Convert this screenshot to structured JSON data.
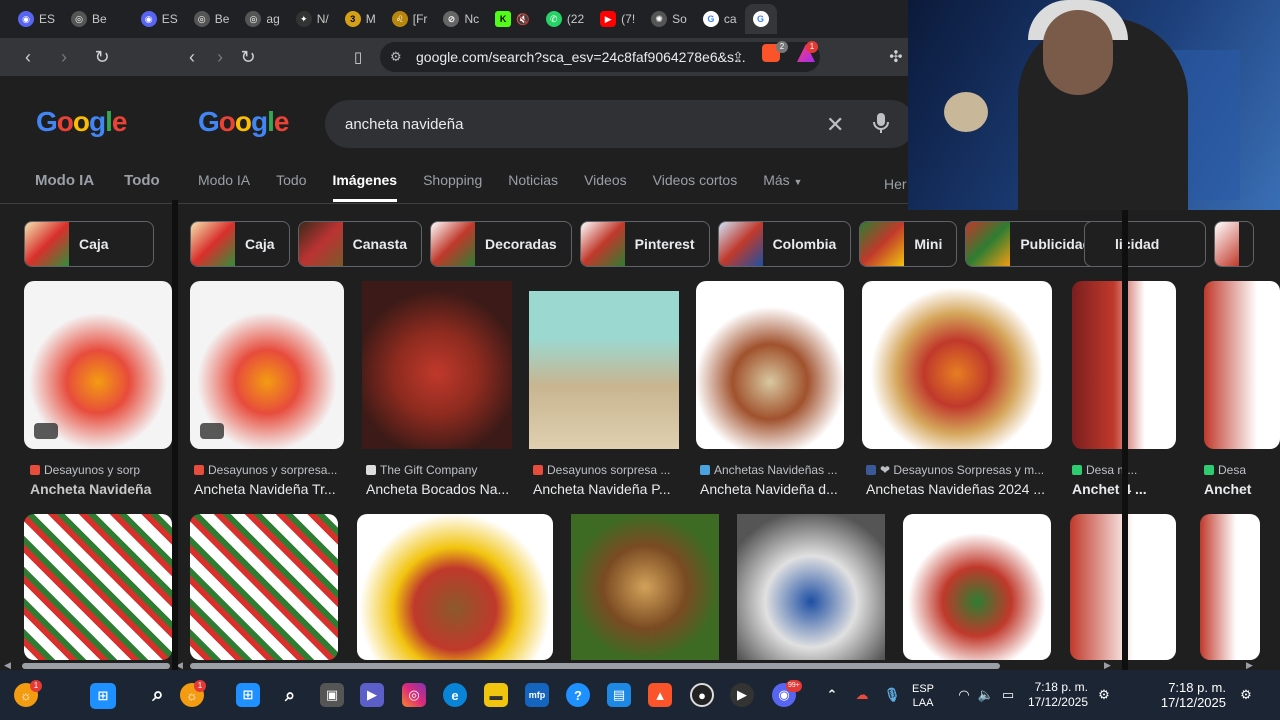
{
  "browser": {
    "tabs": [
      {
        "label": "ES",
        "icon": "discord-icon",
        "color": "#5865f2"
      },
      {
        "label": "Be",
        "icon": "globe-icon",
        "color": "#666666"
      },
      {
        "label": "ES",
        "icon": "discord-icon",
        "color": "#5865f2"
      },
      {
        "label": "Be",
        "icon": "globe-icon",
        "color": "#666666"
      },
      {
        "label": "ag",
        "icon": "globe-icon",
        "color": "#666666"
      },
      {
        "label": "N/",
        "icon": "game-icon",
        "color": "#333333"
      },
      {
        "label": "M",
        "icon": "m-icon",
        "color": "#d4a017"
      },
      {
        "label": "[Fr",
        "icon": "lion-icon",
        "color": "#b8860b"
      },
      {
        "label": "Nc",
        "icon": "block-icon",
        "color": "#888888"
      },
      {
        "label": "",
        "icon": "kick-icon",
        "color": "#53fc18"
      },
      {
        "label": "(22",
        "icon": "whatsapp-icon",
        "color": "#25d366"
      },
      {
        "label": "(7!",
        "icon": "youtube-icon",
        "color": "#ff0000"
      },
      {
        "label": "So",
        "icon": "openai-icon",
        "color": "#aaaaaa"
      },
      {
        "label": "ca",
        "icon": "google-icon",
        "color": "#4285f4"
      },
      {
        "label": "",
        "icon": "google-icon",
        "color": "#4285f4"
      }
    ],
    "url": "google.com/search?sca_esv=24c8faf9064278e6&s..."
  },
  "search": {
    "logo": "Google",
    "query": "ancheta navideña",
    "tabs_left": [
      "Modo IA",
      "Todo"
    ],
    "tabs": [
      "Modo IA",
      "Todo",
      "Imágenes",
      "Shopping",
      "Noticias",
      "Videos",
      "Videos cortos",
      "Más"
    ],
    "tools_partial": "Her"
  },
  "chips": {
    "left": [
      "Caja"
    ],
    "main": [
      "Caja",
      "Canasta",
      "Decoradas",
      "Pinterest",
      "Colombia",
      "Mini",
      "Publicidad"
    ],
    "right": [
      "licidad"
    ]
  },
  "results_row1": [
    {
      "source": "Desayunos y sorpresa...",
      "title": "Ancheta Navideña Tr...",
      "color": "#e74c3c"
    },
    {
      "source": "The Gift Company",
      "title": "Ancheta Bocados Na...",
      "color": "#6b1d1d"
    },
    {
      "source": "Desayunos sorpresa ...",
      "title": "Ancheta Navideña P...",
      "color": "#9bd8d0"
    },
    {
      "source": "Anchetas Navideñas ...",
      "title": "Ancheta Navideña d...",
      "color": "#d8c8a0"
    },
    {
      "source": "❤ Desayunos Sorpresas y m...",
      "title": "Anchetas Navideñas 2024 ...",
      "color": "#f5f5f5"
    }
  ],
  "results_left": [
    {
      "source": "Desayunos y sorp",
      "title": "Ancheta Navideña"
    }
  ],
  "results_right": [
    {
      "source": "Desa m...",
      "title": "Anchet 4 ..."
    },
    {
      "source": "Desa",
      "title": "Anchet"
    }
  ],
  "taskbar": {
    "lang1": "ESP",
    "lang2": "LAA",
    "time": "7:18 p. m.",
    "date": "17/12/2025",
    "badge1": "1",
    "badge2": "1",
    "badge3": "99+"
  }
}
